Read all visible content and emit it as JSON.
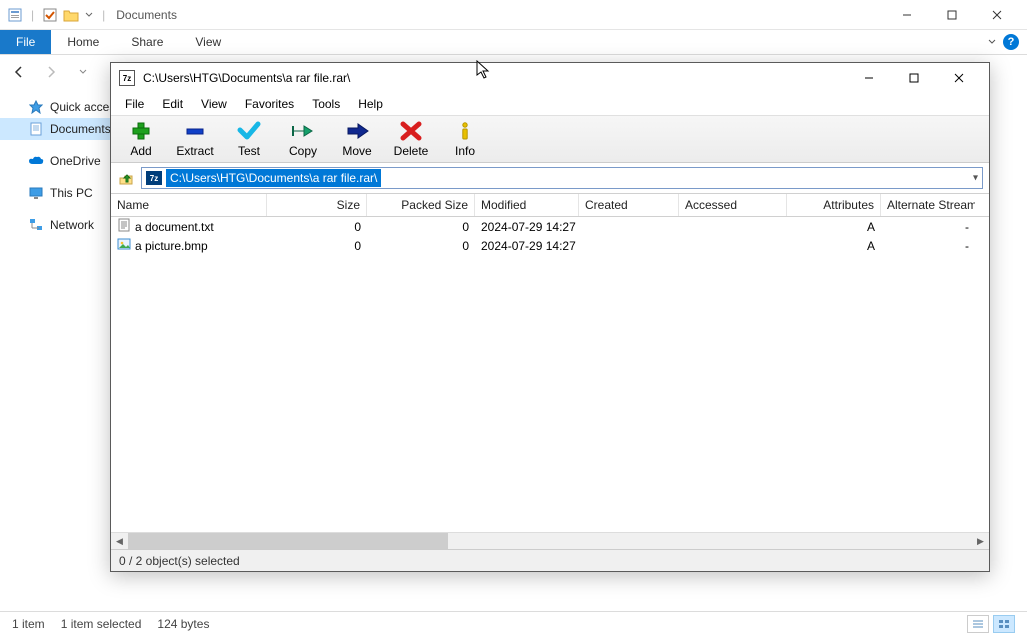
{
  "explorer": {
    "title": "Documents",
    "tabs": {
      "file": "File",
      "home": "Home",
      "share": "Share",
      "view": "View"
    },
    "sidebar": {
      "quick": "Quick access",
      "documents": "Documents",
      "onedrive": "OneDrive",
      "thispc": "This PC",
      "network": "Network"
    },
    "status": {
      "count": "1 item",
      "selected": "1 item selected",
      "size": "124 bytes"
    }
  },
  "sevenzip": {
    "title": "C:\\Users\\HTG\\Documents\\a rar file.rar\\",
    "menu": {
      "file": "File",
      "edit": "Edit",
      "view": "View",
      "favorites": "Favorites",
      "tools": "Tools",
      "help": "Help"
    },
    "toolbar": {
      "add": "Add",
      "extract": "Extract",
      "test": "Test",
      "copy": "Copy",
      "move": "Move",
      "delete": "Delete",
      "info": "Info"
    },
    "path": "C:\\Users\\HTG\\Documents\\a rar file.rar\\",
    "columns": {
      "name": "Name",
      "size": "Size",
      "psize": "Packed Size",
      "modified": "Modified",
      "created": "Created",
      "accessed": "Accessed",
      "attributes": "Attributes",
      "altstream": "Alternate Stream"
    },
    "rows": [
      {
        "name": "a document.txt",
        "size": "0",
        "psize": "0",
        "modified": "2024-07-29 14:27",
        "created": "",
        "accessed": "",
        "attributes": "A",
        "alt": "-",
        "icon": "text"
      },
      {
        "name": "a picture.bmp",
        "size": "0",
        "psize": "0",
        "modified": "2024-07-29 14:27",
        "created": "",
        "accessed": "",
        "attributes": "A",
        "alt": "-",
        "icon": "image"
      }
    ],
    "status": "0 / 2 object(s) selected"
  }
}
